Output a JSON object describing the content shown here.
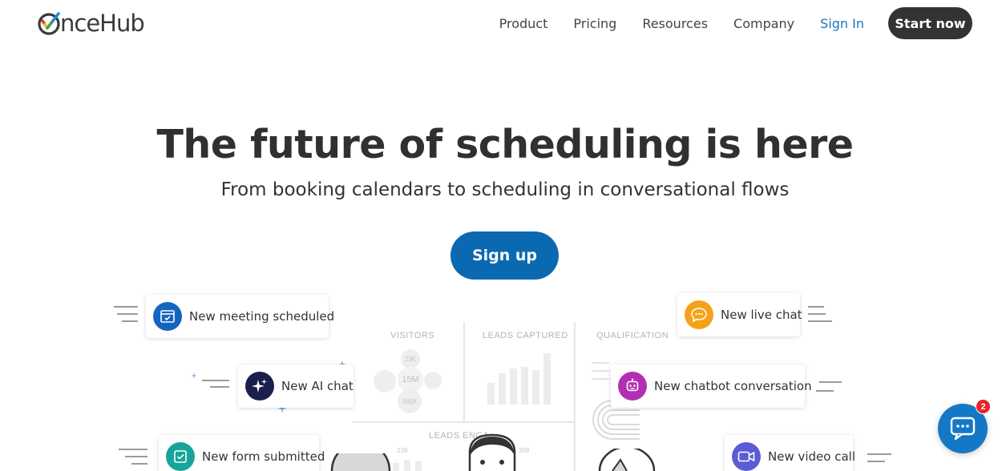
{
  "header": {
    "logo_text": "nceHub",
    "nav": [
      "Product",
      "Pricing",
      "Resources",
      "Company"
    ],
    "sign_in": "Sign In",
    "start_now": "Start now"
  },
  "hero": {
    "title": "The future of scheduling is here",
    "subtitle": "From booking calendars to scheduling in conversational flows",
    "cta": "Sign up"
  },
  "cards": {
    "meeting": {
      "label": "New meeting scheduled",
      "icon": "calendar-check-icon",
      "color": "#1565c0"
    },
    "ai_chat": {
      "label": "New AI chat",
      "icon": "sparkle-icon",
      "color": "#1a1f4b"
    },
    "form": {
      "label": "New form submitted",
      "icon": "form-check-icon",
      "color": "#16a59a"
    },
    "live_chat": {
      "label": "New live chat",
      "icon": "chat-bubble-icon",
      "color": "#f5a21a"
    },
    "chatbot": {
      "label": "New chatbot conversation",
      "icon": "robot-icon",
      "color": "#b32fb2"
    },
    "video": {
      "label": "New video call",
      "icon": "video-camera-icon",
      "color": "#5b5bd6"
    }
  },
  "dashboard": {
    "visitors": "VISITORS",
    "leads_captured": "LEADS CAPTURED",
    "qualification": "QUALIFICATION",
    "leads_engaged": "LEADS ENGA",
    "visitors_total": "15M",
    "visitors_a": "23K",
    "visitors_b": "345K",
    "num_238": "238",
    "num_309": "309"
  },
  "chat_widget": {
    "badge": "2",
    "icon": "chat-dots-icon",
    "color": "#1478c6"
  }
}
